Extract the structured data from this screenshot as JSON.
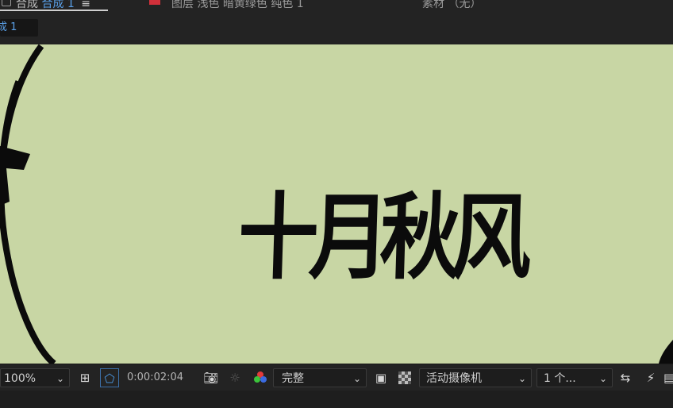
{
  "tabs": {
    "composition": {
      "prefix": "合成",
      "name": "合成 1",
      "menu": "≡"
    },
    "layer": {
      "label": "图层 浅色 暗黄绿色 纯色 1"
    },
    "footage": {
      "label": "素材 （无）"
    }
  },
  "breadcrumb": {
    "label": "成 1"
  },
  "viewer": {
    "background_color": "#c8d6a4",
    "text": "十月秋风",
    "text_color": "#0b0b0b"
  },
  "toolbar": {
    "zoom": "100%",
    "timecode": "0:00:02:04",
    "resolution": "完整",
    "camera": "活动摄像机",
    "views": "1 个...",
    "icons": {
      "grid": "grid-guides-icon",
      "mask": "mask-visibility-icon",
      "snapshot": "camera-snapshot-icon",
      "show_snapshot": "show-snapshot-icon",
      "channels": "rgb-channels-icon",
      "region": "region-of-interest-icon",
      "transparency": "transparency-grid-icon",
      "draft3d": "draft-3d-icon",
      "fast_preview": "fast-preview-icon"
    }
  }
}
